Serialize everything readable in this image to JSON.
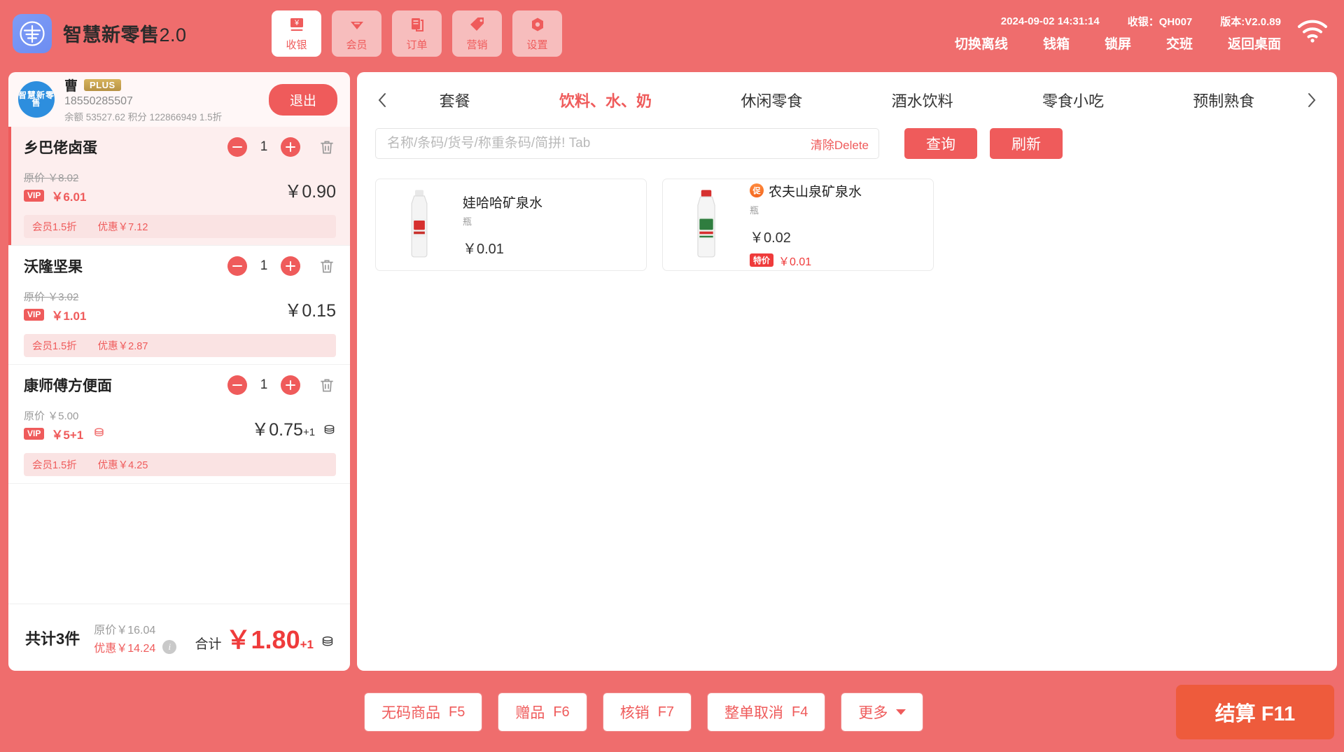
{
  "header": {
    "brand_name": "智慧新零售",
    "brand_version": "2.0",
    "nav": [
      {
        "label": "收银",
        "icon": "cashier-icon",
        "active": true
      },
      {
        "label": "会员",
        "icon": "member-icon",
        "active": false
      },
      {
        "label": "订单",
        "icon": "order-icon",
        "active": false
      },
      {
        "label": "营销",
        "icon": "marketing-icon",
        "active": false
      },
      {
        "label": "设置",
        "icon": "settings-icon",
        "active": false
      }
    ],
    "datetime": "2024-09-02 14:31:14",
    "cashier_label": "收银：QH007",
    "version_label": "版本:V2.0.89",
    "actions": [
      "切换离线",
      "钱箱",
      "锁屏",
      "交班",
      "返回桌面"
    ],
    "wifi_icon": "wifi-icon"
  },
  "customer": {
    "name": "曹",
    "badge": "PLUS",
    "phone": "18550285507",
    "meta": "余额 53527.62  积分 122866949  1.5折",
    "logout_label": "退出",
    "avatar_text": "智慧新零售"
  },
  "cart": {
    "items": [
      {
        "name": "乡巴佬卤蛋",
        "qty": "1",
        "orig_label": "原价 ￥8.02",
        "orig_strike": true,
        "vip_badge": "VIP",
        "vip_price": "￥6.01",
        "vip_has_coin": false,
        "line_total": "￥0.90",
        "line_total_sup": "",
        "line_total_coin": false,
        "discount_rate": "会员1.5折",
        "discount_amount": "优惠￥7.12",
        "discount_highlight": true,
        "selected": true
      },
      {
        "name": "沃隆坚果",
        "qty": "1",
        "orig_label": "原价 ￥3.02",
        "orig_strike": true,
        "vip_badge": "VIP",
        "vip_price": "￥1.01",
        "vip_has_coin": false,
        "line_total": "￥0.15",
        "line_total_sup": "",
        "line_total_coin": false,
        "discount_rate": "会员1.5折",
        "discount_amount": "优惠￥2.87",
        "discount_highlight": true,
        "selected": false
      },
      {
        "name": "康师傅方便面",
        "qty": "1",
        "orig_label": "原价 ￥5.00",
        "orig_strike": false,
        "vip_badge": "VIP",
        "vip_price": "￥5+1",
        "vip_has_coin": true,
        "line_total": "￥0.75",
        "line_total_sup": "+1",
        "line_total_coin": true,
        "discount_rate": "会员1.5折",
        "discount_amount": "优惠￥4.25",
        "discount_highlight": true,
        "selected": false
      }
    ],
    "minus_icon": "minus-circle-icon",
    "plus_icon": "plus-circle-icon",
    "delete_icon": "trash-icon"
  },
  "totals": {
    "count_label": "共计3件",
    "orig_label": "原价￥16.04",
    "discount_label": "优惠￥14.24",
    "info_icon": "info-icon",
    "sum_label": "合计",
    "sum_value": "￥1.80",
    "sum_sup": "+1",
    "sum_coin_icon": "coin-icon"
  },
  "categories": {
    "prev_icon": "chevron-left-icon",
    "next_icon": "chevron-right-icon",
    "items": [
      {
        "label": "套餐",
        "active": false
      },
      {
        "label": "饮料、水、奶",
        "active": true
      },
      {
        "label": "休闲零食",
        "active": false
      },
      {
        "label": "酒水饮料",
        "active": false
      },
      {
        "label": "零食小吃",
        "active": false
      },
      {
        "label": "预制熟食",
        "active": false
      }
    ]
  },
  "search": {
    "value": "",
    "placeholder": "名称/条码/货号/称重条码/简拼! Tab",
    "clear_label": "清除Delete",
    "query_label": "查询",
    "refresh_label": "刷新"
  },
  "products": [
    {
      "name": "娃哈哈矿泉水",
      "unit": "瓶",
      "price": "￥0.01",
      "promo": false,
      "promo_badge": "",
      "special_badge": "",
      "special_price": "",
      "image": "water-bottle-wahaha"
    },
    {
      "name": "农夫山泉矿泉水",
      "unit": "瓶",
      "price": "￥0.02",
      "promo": true,
      "promo_badge": "促",
      "special_badge": "特价",
      "special_price": "￥0.01",
      "image": "water-bottle-nongfu"
    }
  ],
  "footer": {
    "buttons": [
      {
        "label": "无码商品",
        "key": "F5"
      },
      {
        "label": "赠品",
        "key": "F6"
      },
      {
        "label": "核销",
        "key": "F7"
      },
      {
        "label": "整单取消",
        "key": "F4"
      },
      {
        "label": "更多",
        "key": ""
      }
    ],
    "checkout_label": "结算 F11"
  },
  "colors": {
    "brand_red": "#ef5b5b",
    "header_bg": "#ef6d6d",
    "checkout_orange": "#ee5b3c",
    "gold_badge": "#b79244"
  }
}
